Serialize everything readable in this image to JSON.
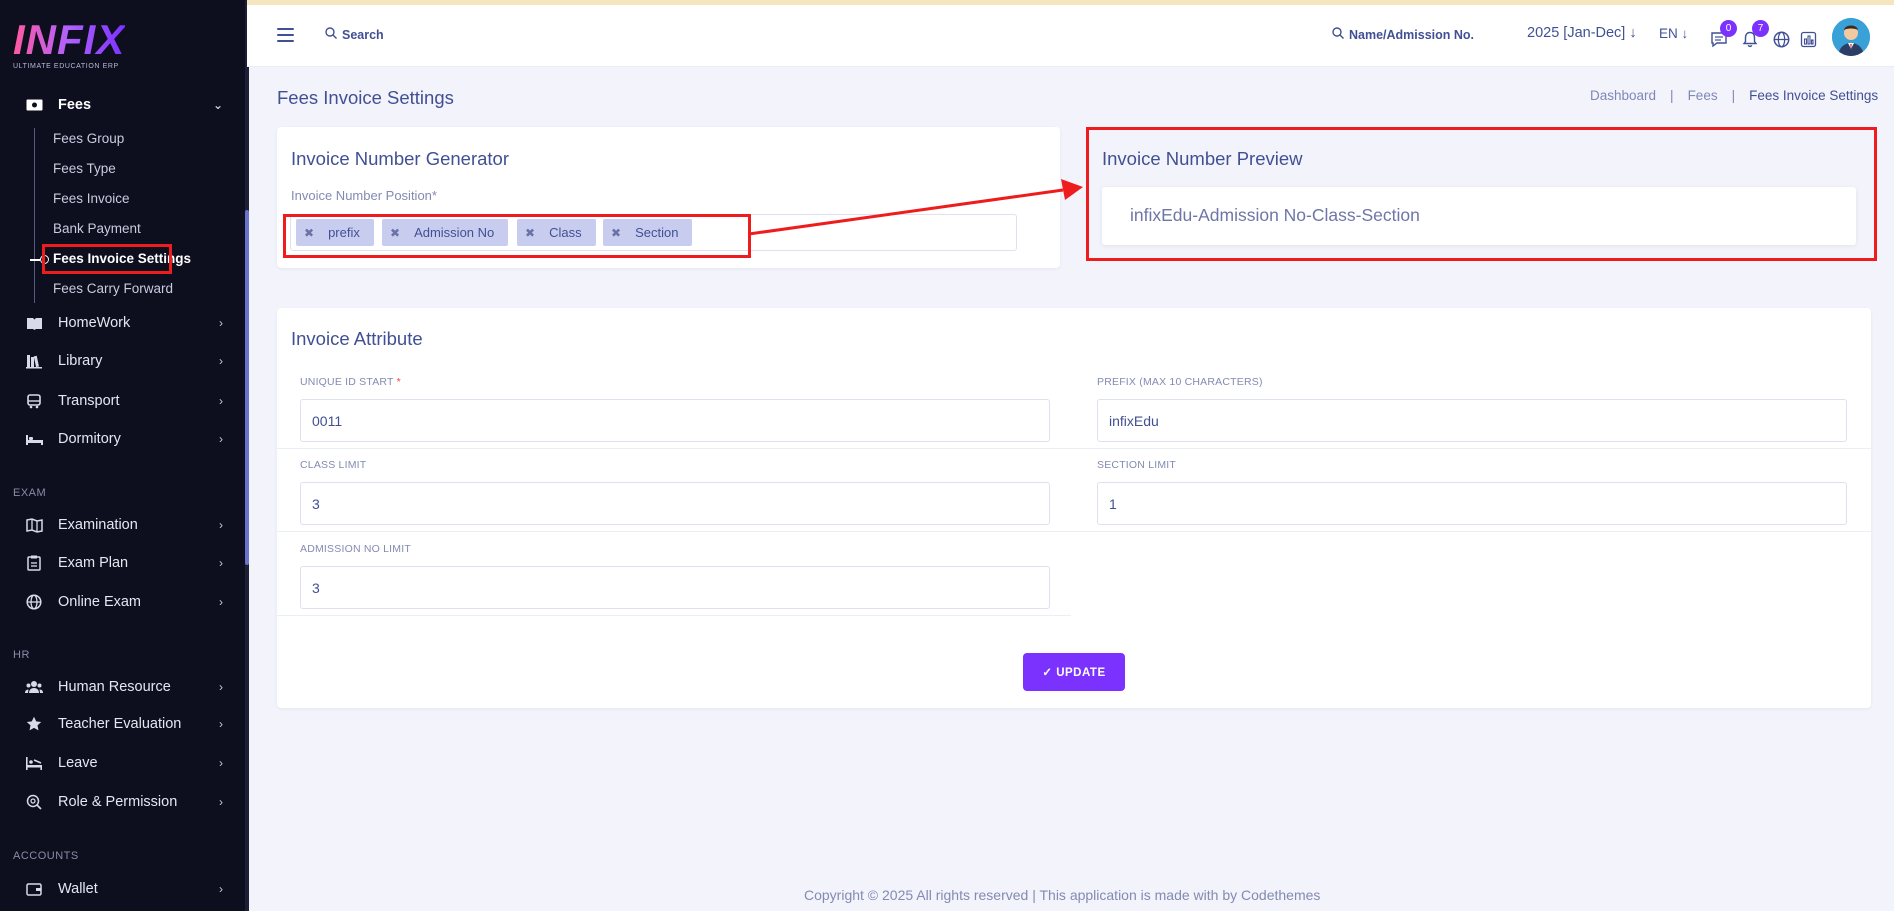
{
  "app": {
    "logo_text": "INFIX",
    "logo_subtitle": "ULTIMATE EDUCATION ERP"
  },
  "sidebar": {
    "fees": {
      "label": "Fees",
      "items": [
        "Fees Group",
        "Fees Type",
        "Fees Invoice",
        "Bank Payment",
        "Fees Invoice Settings",
        "Fees Carry Forward"
      ]
    },
    "menu": [
      {
        "label": "HomeWork",
        "icon": "book-icon"
      },
      {
        "label": "Library",
        "icon": "library-icon"
      },
      {
        "label": "Transport",
        "icon": "bus-icon"
      },
      {
        "label": "Dormitory",
        "icon": "bed-icon"
      }
    ],
    "section_exam": "EXAM",
    "exam_menu": [
      {
        "label": "Examination",
        "icon": "map-icon"
      },
      {
        "label": "Exam Plan",
        "icon": "clipboard-icon"
      },
      {
        "label": "Online Exam",
        "icon": "globe-icon"
      }
    ],
    "section_hr": "HR",
    "hr_menu": [
      {
        "label": "Human Resource",
        "icon": "users-icon"
      },
      {
        "label": "Teacher Evaluation",
        "icon": "star-icon"
      },
      {
        "label": "Leave",
        "icon": "leave-icon"
      },
      {
        "label": "Role & Permission",
        "icon": "key-icon"
      }
    ],
    "section_accounts": "ACCOUNTS",
    "accounts_menu": [
      {
        "label": "Wallet",
        "icon": "wallet-icon"
      }
    ]
  },
  "header": {
    "search_label": "Search",
    "name_search_label": "Name/Admission No.",
    "year_label": "2025 [Jan-Dec]",
    "lang_label": "EN",
    "messages_count": "0",
    "notifications_count": "7"
  },
  "page": {
    "title": "Fees Invoice Settings",
    "breadcrumb": [
      "Dashboard",
      "Fees",
      "Fees Invoice Settings"
    ]
  },
  "generator": {
    "title": "Invoice Number Generator",
    "position_label": "Invoice Number Position*",
    "tags": [
      "prefix",
      "Admission No",
      "Class",
      "Section"
    ]
  },
  "preview": {
    "title": "Invoice Number Preview",
    "value": "infixEdu-Admission No-Class-Section"
  },
  "attribute": {
    "title": "Invoice Attribute",
    "unique_id_label": "UNIQUE ID START",
    "unique_id_required": "*",
    "unique_id_value": "0011",
    "prefix_label": "PREFIX (MAX 10 CHARACTERS)",
    "prefix_value": "infixEdu",
    "class_limit_label": "CLASS LIMIT",
    "class_limit_value": "3",
    "section_limit_label": "SECTION LIMIT",
    "section_limit_value": "1",
    "admission_limit_label": "ADMISSION NO LIMIT",
    "admission_limit_value": "3",
    "update_label": "✓ UPDATE"
  },
  "footer": {
    "text": "Copyright © 2025 All rights reserved | This application is made with by Codethemes"
  },
  "colors": {
    "sidebar_bg": "#0d0f1e",
    "accent": "#7c32ff",
    "text_primary": "#415094",
    "annotation": "#ee1c1c"
  }
}
